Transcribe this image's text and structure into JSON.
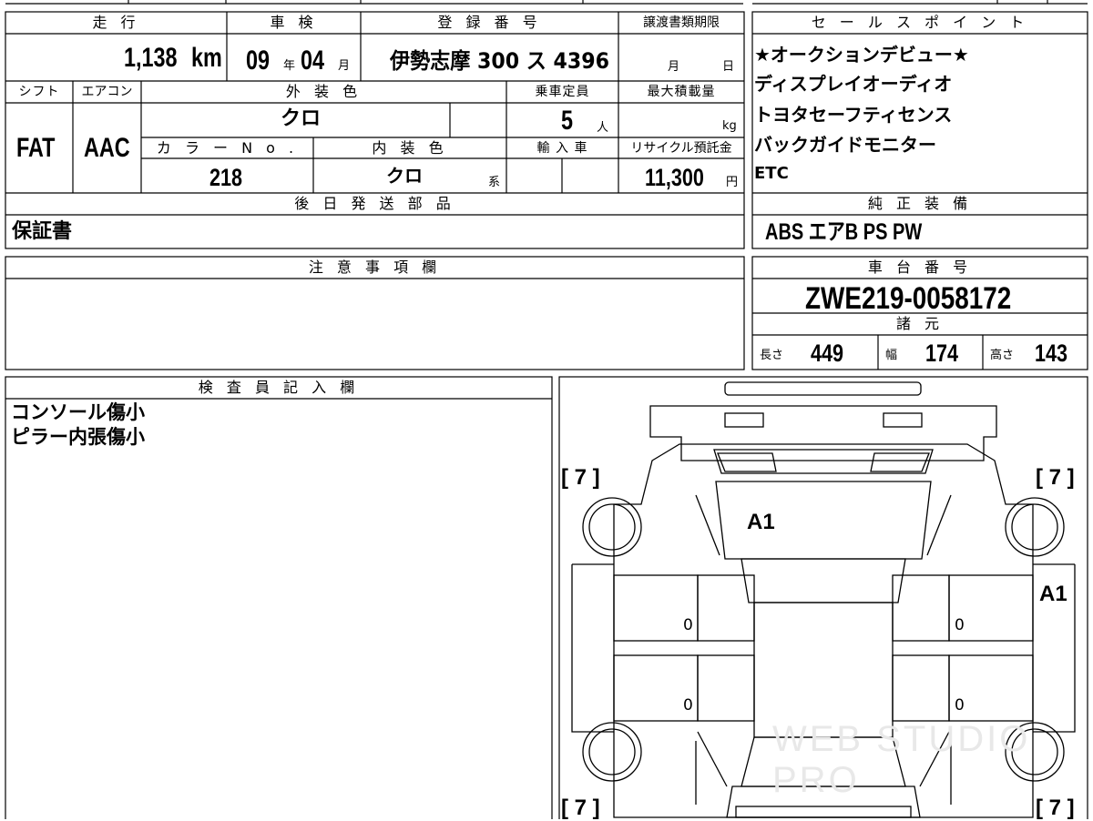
{
  "labels": {
    "mileage": "走 行",
    "inspection": "車 検",
    "registration": "登 録 番 号",
    "transfer_deadline": "譲渡書類期限",
    "sales_point": "セ ー ル ス ポ イ ン ト",
    "shift": "シフト",
    "aircon": "エアコン",
    "exterior_color": "外 装 色",
    "capacity": "乗車定員",
    "max_load": "最大積載量",
    "color_no": "カ ラ ー N o .",
    "interior_color": "内 装 色",
    "import": "輸 入 車",
    "recycle": "リサイクル預託金",
    "later_parts": "後 日 発 送 部 品",
    "standard_equipment": "純 正 装 備",
    "notes": "注 意 事 項 欄",
    "chassis_no": "車 台 番 号",
    "specs": "諸 元",
    "inspector_notes": "検 査 員 記 入 欄",
    "length": "長さ",
    "width": "幅",
    "height": "高さ"
  },
  "vehicle": {
    "mileage": "1,138",
    "mileage_unit": "km",
    "inspection_year": "09",
    "year_unit": "年",
    "inspection_month": "04",
    "month_unit": "月",
    "registration": "伊勢志摩 300 ス 4396",
    "deadline_month_unit": "月",
    "deadline_day_unit": "日",
    "shift": "FAT",
    "aircon": "AAC",
    "exterior_color": "クロ",
    "capacity": "5",
    "capacity_unit": "人",
    "max_load_unit": "kg",
    "color_no": "218",
    "interior_color": "クロ",
    "interior_suffix": "系",
    "recycle_fee": "11,300",
    "yen": "円",
    "later_parts": "保証書",
    "chassis_no": "ZWE219-0058172",
    "length": "449",
    "width": "174",
    "height": "143"
  },
  "sales_points": [
    "★オークションデビュー★",
    "ディスプレイオーディオ",
    "トヨタセーフティセンス",
    "バックガイドモニター",
    "ETC"
  ],
  "equipment": "ABS エアB PS PW",
  "inspector_notes": [
    "コンソール傷小",
    "ピラー内張傷小"
  ],
  "diagram": {
    "tire_tl": "[ 7 ]",
    "tire_tr": "[ 7 ]",
    "tire_bl": "[ 7 ]",
    "tire_br": "[ 7 ]",
    "mark_windshield": "A1",
    "mark_right_pillar": "A1",
    "door_mark": "0",
    "watermark": "WEB STUDIO PRO"
  }
}
